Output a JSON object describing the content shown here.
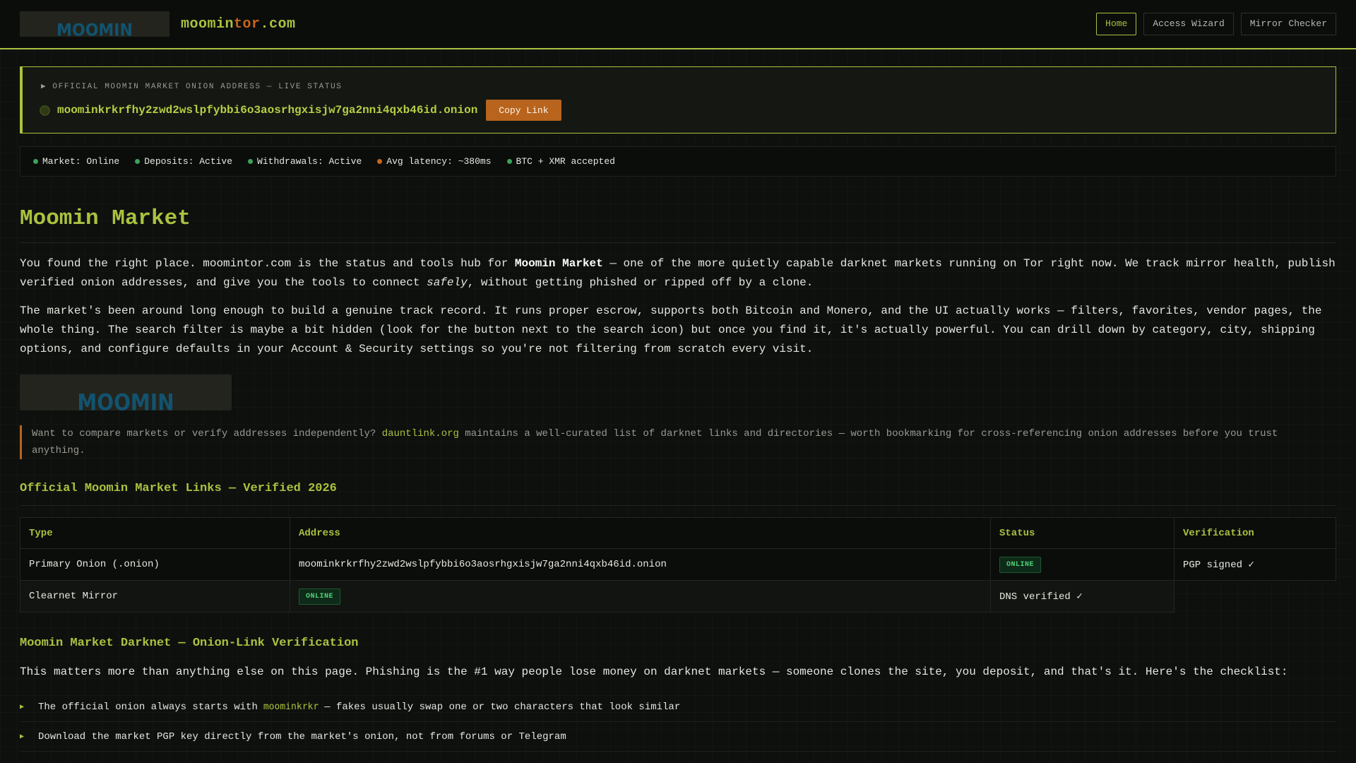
{
  "header": {
    "logo_text": "MOOMIN",
    "site_name_part1": "moomin",
    "site_name_part2": "tor",
    "site_name_part3": ".com",
    "nav": [
      {
        "label": "Home",
        "active": true
      },
      {
        "label": "Access Wizard",
        "active": false
      },
      {
        "label": "Mirror Checker",
        "active": false
      }
    ]
  },
  "status_panel": {
    "kicker": "▶ OFFICIAL MOOMIN MARKET ONION ADDRESS — LIVE STATUS",
    "address": "moominkrkrfhy2zwd2wslpfybbi6o3aosrhgxisjw7ga2nni4qxb46id.onion",
    "copy_label": "Copy Link"
  },
  "indicators": [
    {
      "text": "Market: Online",
      "color": "#3ba35a"
    },
    {
      "text": "Deposits: Active",
      "color": "#3ba35a"
    },
    {
      "text": "Withdrawals: Active",
      "color": "#3ba35a"
    },
    {
      "text": "Avg latency: ~380ms",
      "color": "#c8661a"
    },
    {
      "text": "BTC + XMR accepted",
      "color": "#3ba35a"
    }
  ],
  "main": {
    "title": "Moomin Market",
    "p1_a": "You found the right place. moomintor.com is the status and tools hub for ",
    "p1_strong": "Moomin Market",
    "p1_b": " — one of the more quietly capable darknet markets running on Tor right now. We track mirror health, publish verified onion addresses, and give you the tools to connect ",
    "p1_em": "safely",
    "p1_c": ", without getting phished or ripped off by a clone.",
    "p2": "The market's been around long enough to build a genuine track record. It runs proper escrow, supports both Bitcoin and Monero, and the UI actually works — filters, favorites, vendor pages, the whole thing. The search filter is maybe a bit hidden (look for the button next to the search icon) but once you find it, it's actually powerful. You can drill down by category, city, shipping options, and configure defaults in your Account & Security settings so you're not filtering from scratch every visit.",
    "banner_text": "MOOMIN",
    "note_a": "Want to compare markets or verify addresses independently? ",
    "note_link": "dauntlink.org",
    "note_b": " maintains a well-curated list of darknet links and directories — worth bookmarking for cross-referencing onion addresses before you trust anything."
  },
  "links_section": {
    "heading": "Official Moomin Market Links — Verified 2026",
    "columns": [
      "Type",
      "Address",
      "Status",
      "Verification"
    ],
    "rows": [
      {
        "type": "Primary Onion (.onion)",
        "address": "moominkrkrfhy2zwd2wslpfybbi6o3aosrhgxisjw7ga2nni4qxb46id.onion",
        "status": "ONLINE",
        "verification": "PGP signed ✓"
      },
      {
        "type": "Clearnet Mirror",
        "status": "ONLINE",
        "verification": "DNS verified ✓"
      }
    ]
  },
  "verify_section": {
    "heading": "Moomin Market Darknet — Onion-Link Verification",
    "lead": "This matters more than anything else on this page. Phishing is the #1 way people lose money on darknet markets — someone clones the site, you deposit, and that's it. Here's the checklist:",
    "items": [
      {
        "a": "The official onion always starts with",
        "code": "moominkrkr",
        "b": "— fakes usually swap one or two characters that look similar"
      },
      {
        "a": "Download the market PGP key directly from the market's onion, not from forums or Telegram",
        "code": "",
        "b": ""
      }
    ]
  }
}
